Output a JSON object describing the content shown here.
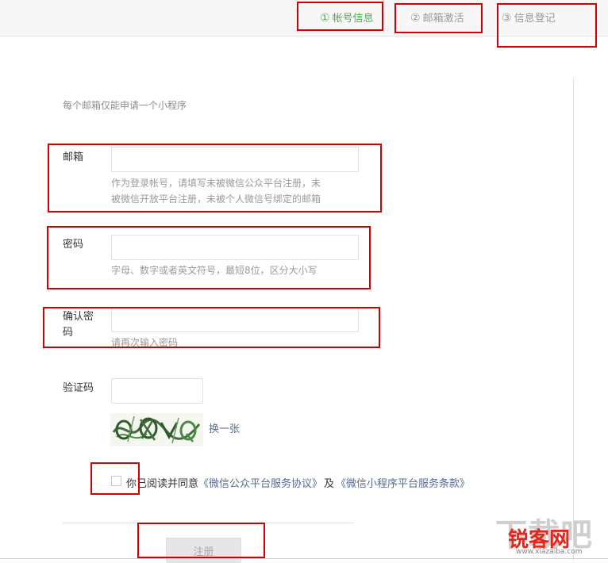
{
  "steps": [
    {
      "number": "①",
      "label": "帐号信息",
      "active": true
    },
    {
      "number": "②",
      "label": "邮箱激活",
      "active": false
    },
    {
      "number": "③",
      "label": "信息登记",
      "active": false
    }
  ],
  "intro": "每个邮箱仅能申请一个小程序",
  "form": {
    "email": {
      "label": "邮箱",
      "value": "",
      "tip_line1": "作为登录帐号，请填写未被微信公众平台注册，未",
      "tip_line2": "被微信开放平台注册，未被个人微信号绑定的邮箱"
    },
    "password": {
      "label": "密码",
      "value": "",
      "tip": "字母、数字或者英文符号，最短8位，区分大小写"
    },
    "confirm": {
      "label_line1": "确认密",
      "label_line2": "码",
      "value": "",
      "tip": "请再次输入密码"
    },
    "captcha": {
      "label": "验证码",
      "value": "",
      "refresh": "换一张"
    }
  },
  "agreement": {
    "prefix": "你已阅读并同意",
    "link1": "《微信公众平台服务协议》",
    "and": "及",
    "link2": "《微信小程序平台服务条款》",
    "checked": false
  },
  "submit_label": "注册",
  "watermark": {
    "big": "下载吧",
    "red": "锐客网",
    "url": "www.xiazaiba.com"
  },
  "colors": {
    "active_step": "#44b549",
    "highlight_box": "#d40000",
    "link": "#576b95"
  }
}
